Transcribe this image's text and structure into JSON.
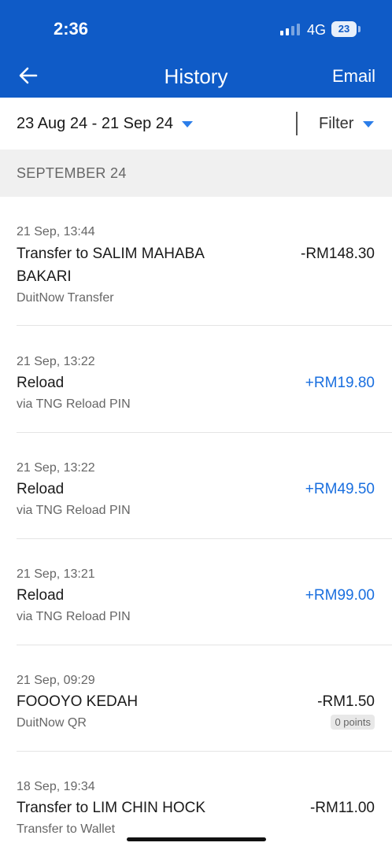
{
  "status_bar": {
    "time": "2:36",
    "network": "4G",
    "battery": "23"
  },
  "header": {
    "title": "History",
    "email_label": "Email"
  },
  "filter_bar": {
    "date_range": "23 Aug 24 - 21 Sep 24",
    "filter_label": "Filter"
  },
  "section": {
    "label": "SEPTEMBER 24"
  },
  "transactions": [
    {
      "datetime": "21 Sep, 13:44",
      "title": "Transfer to SALIM MAHABA BAKARI",
      "subtitle": "DuitNow Transfer",
      "amount": "-RM148.30",
      "positive": false
    },
    {
      "datetime": "21 Sep, 13:22",
      "title": "Reload",
      "subtitle": "via TNG Reload PIN",
      "amount": "+RM19.80",
      "positive": true
    },
    {
      "datetime": "21 Sep, 13:22",
      "title": "Reload",
      "subtitle": "via TNG Reload PIN",
      "amount": "+RM49.50",
      "positive": true
    },
    {
      "datetime": "21 Sep, 13:21",
      "title": "Reload",
      "subtitle": "via TNG Reload PIN",
      "amount": "+RM99.00",
      "positive": true
    },
    {
      "datetime": "21 Sep, 09:29",
      "title": "FOOOYO KEDAH",
      "subtitle": "DuitNow QR",
      "amount": "-RM1.50",
      "positive": false,
      "points": "0 points"
    },
    {
      "datetime": "18 Sep, 19:34",
      "title": "Transfer to LIM CHIN HOCK",
      "subtitle": "Transfer to Wallet",
      "amount": "-RM11.00",
      "positive": false
    }
  ],
  "colors": {
    "header": "#0f5bc7",
    "positive_amount": "#1a6fdf",
    "caret": "#2b7de9",
    "section_bg": "#f0f0f0"
  }
}
